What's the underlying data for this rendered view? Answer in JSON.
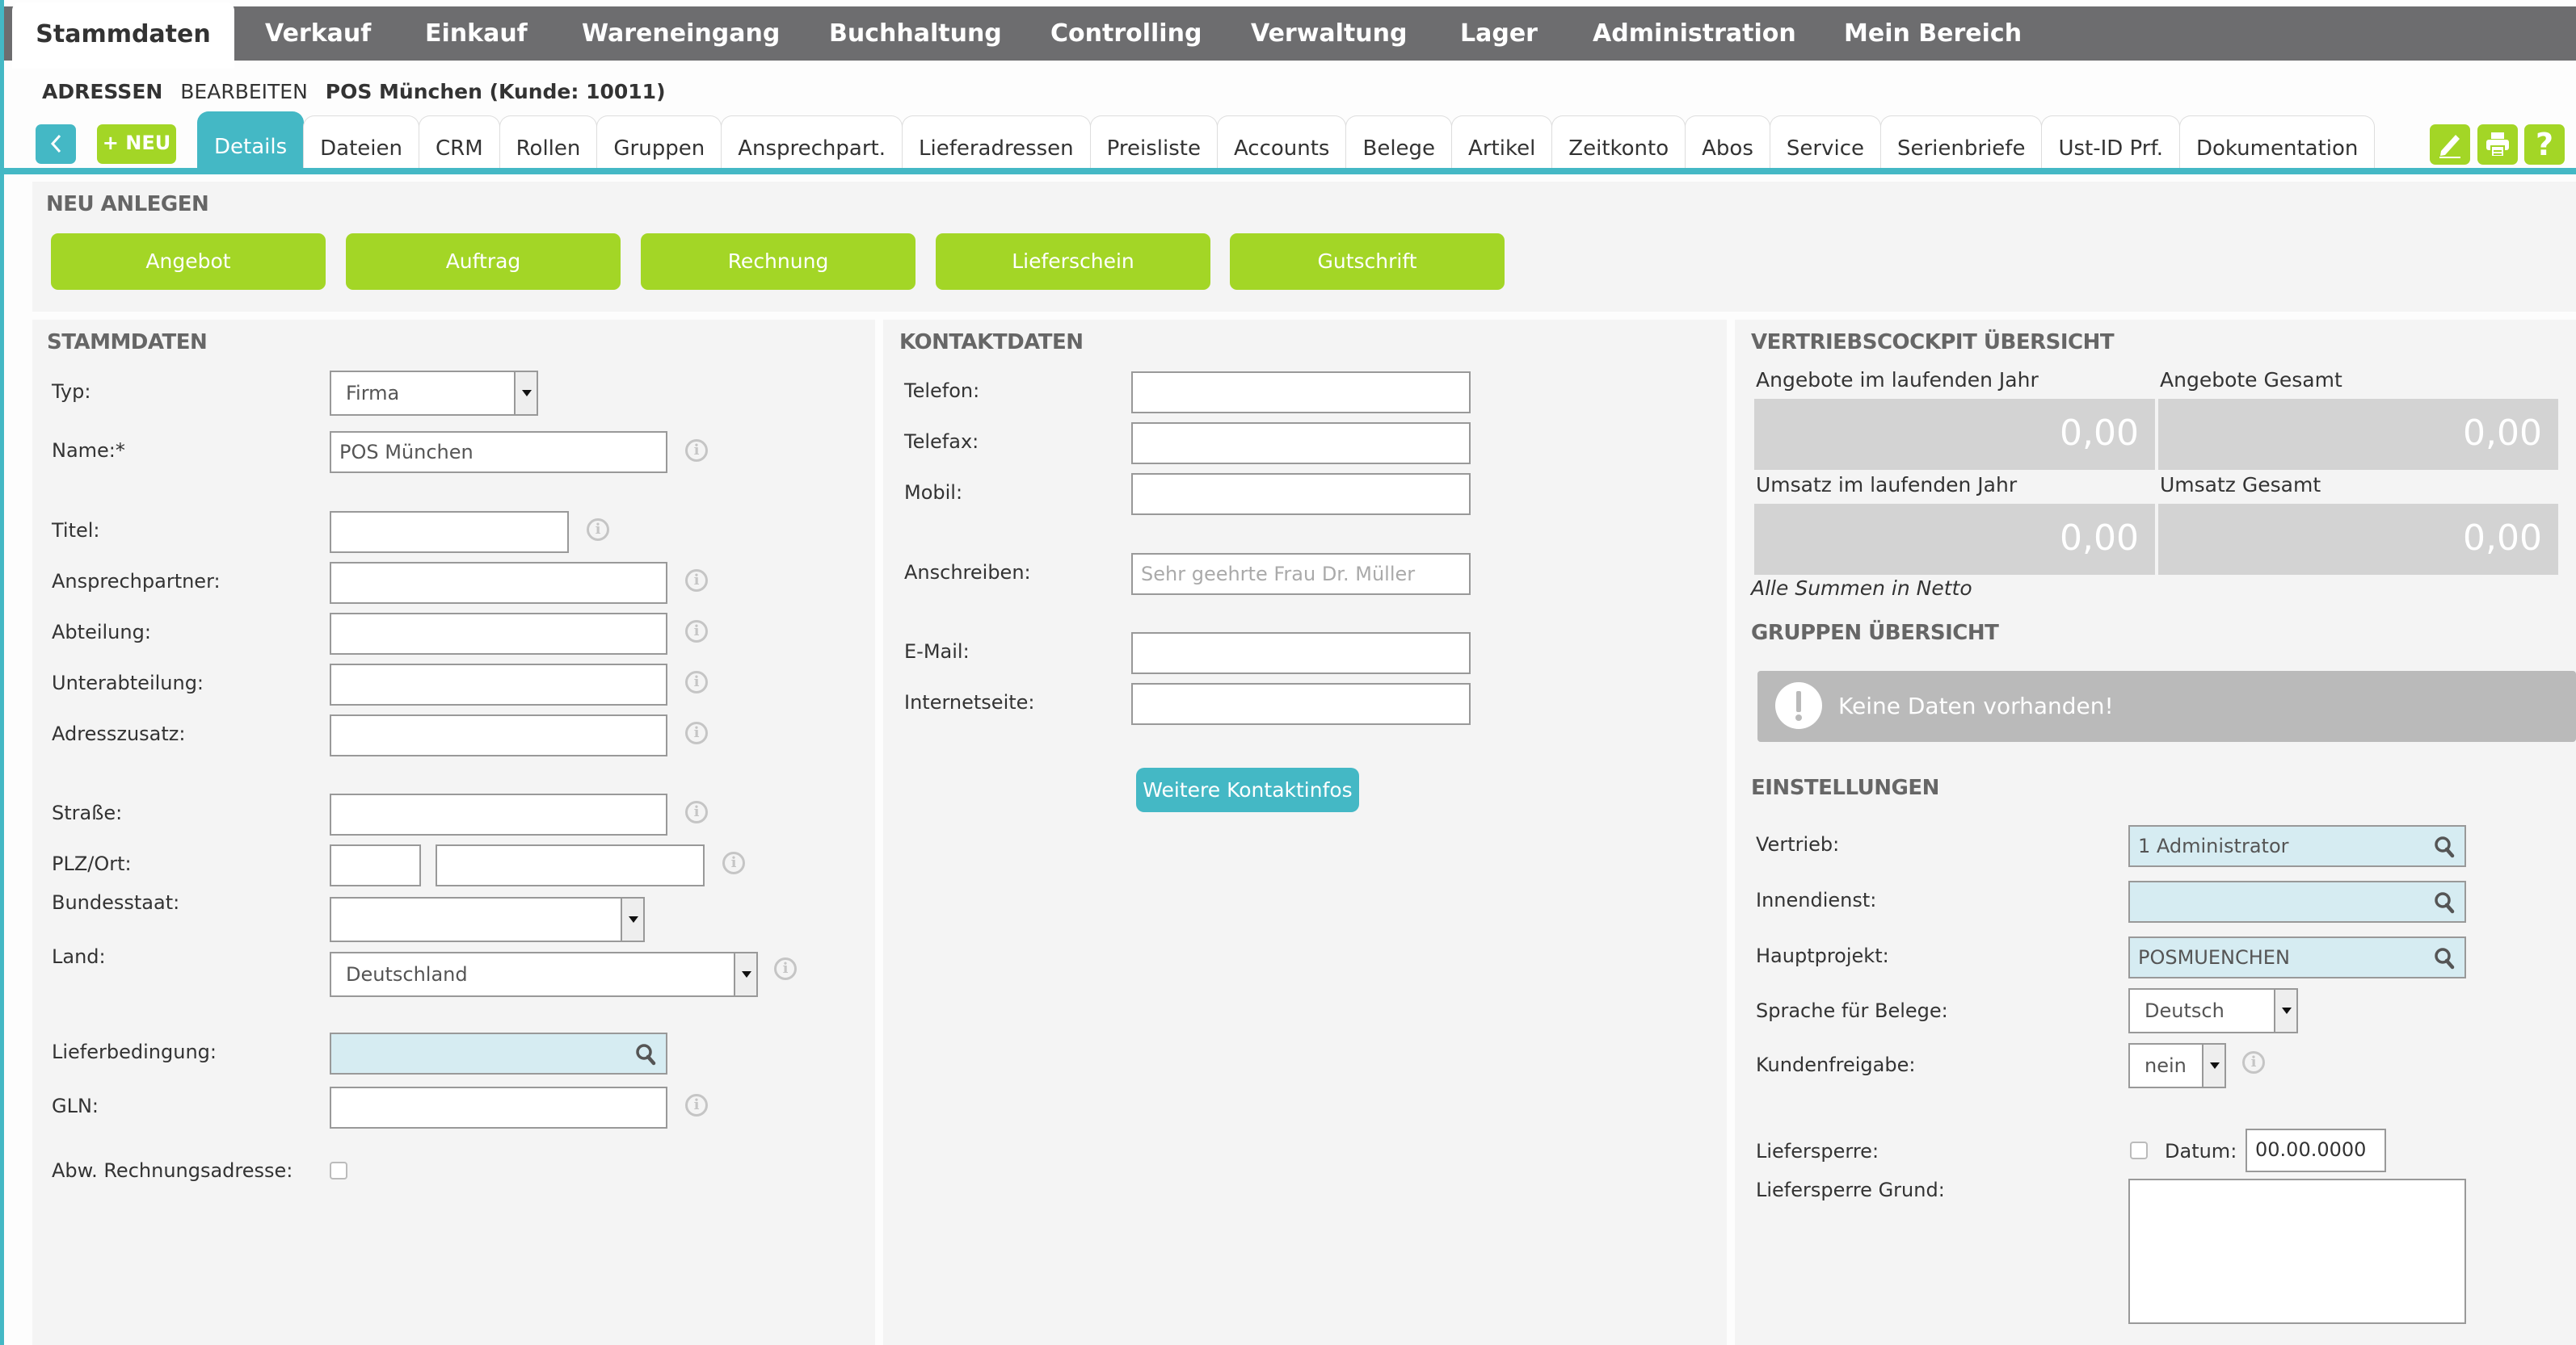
{
  "topnav": {
    "items": [
      "Stammdaten",
      "Verkauf",
      "Einkauf",
      "Wareneingang",
      "Buchhaltung",
      "Controlling",
      "Verwaltung",
      "Lager",
      "Administration",
      "Mein Bereich"
    ],
    "active": "Stammdaten"
  },
  "breadcrumb": {
    "module": "ADRESSEN",
    "action": "BEARBEITEN",
    "record": "POS München (Kunde: 10011)"
  },
  "toolbar": {
    "back_icon": "chevron-left-icon",
    "new_label": "+ NEU",
    "right_icons": [
      "pencil-icon",
      "printer-icon",
      "help-icon"
    ]
  },
  "tabs": [
    "Details",
    "Dateien",
    "CRM",
    "Rollen",
    "Gruppen",
    "Ansprechpart.",
    "Lieferadressen",
    "Preisliste",
    "Accounts",
    "Belege",
    "Artikel",
    "Zeitkonto",
    "Abos",
    "Service",
    "Serienbriefe",
    "Ust-ID Prf.",
    "Dokumentation"
  ],
  "active_tab": "Details",
  "neu_anlegen": {
    "title": "NEU ANLEGEN",
    "buttons": [
      "Angebot",
      "Auftrag",
      "Rechnung",
      "Lieferschein",
      "Gutschrift"
    ]
  },
  "stammdaten": {
    "title": "STAMMDATEN",
    "typ": {
      "label": "Typ:",
      "value": "Firma"
    },
    "name": {
      "label": "Name:*",
      "value": "POS München"
    },
    "titel": {
      "label": "Titel:",
      "value": ""
    },
    "ansprechpartner": {
      "label": "Ansprechpartner:",
      "value": ""
    },
    "abteilung": {
      "label": "Abteilung:",
      "value": ""
    },
    "unterabteilung": {
      "label": "Unterabteilung:",
      "value": ""
    },
    "adresszusatz": {
      "label": "Adresszusatz:",
      "value": ""
    },
    "strasse": {
      "label": "Straße:",
      "value": ""
    },
    "plz_ort": {
      "label": "PLZ/Ort:",
      "plz": "",
      "ort": ""
    },
    "bundesstaat": {
      "label": "Bundesstaat:",
      "value": ""
    },
    "land": {
      "label": "Land:",
      "value": "Deutschland"
    },
    "lieferbedingung": {
      "label": "Lieferbedingung:",
      "value": ""
    },
    "gln": {
      "label": "GLN:",
      "value": ""
    },
    "abw_rechnungsadresse": {
      "label": "Abw. Rechnungsadresse:",
      "checked": false
    }
  },
  "kontaktdaten": {
    "title": "KONTAKTDATEN",
    "telefon": {
      "label": "Telefon:",
      "value": ""
    },
    "telefax": {
      "label": "Telefax:",
      "value": ""
    },
    "mobil": {
      "label": "Mobil:",
      "value": ""
    },
    "anschreiben": {
      "label": "Anschreiben:",
      "value": "",
      "placeholder": "Sehr geehrte Frau Dr. Müller"
    },
    "email": {
      "label": "E-Mail:",
      "value": ""
    },
    "internetseite": {
      "label": "Internetseite:",
      "value": ""
    },
    "more_button": "Weitere Kontaktinfos"
  },
  "vertriebscockpit": {
    "title": "VERTRIEBSCOCKPIT ÜBERSICHT",
    "kpis": [
      {
        "label": "Angebote im laufenden Jahr",
        "value": "0,00"
      },
      {
        "label": "Angebote Gesamt",
        "value": "0,00"
      },
      {
        "label": "Umsatz im laufenden Jahr",
        "value": "0,00"
      },
      {
        "label": "Umsatz Gesamt",
        "value": "0,00"
      }
    ],
    "note": "Alle Summen in Netto"
  },
  "gruppen": {
    "title": "GRUPPEN ÜBERSICHT",
    "empty_message": "Keine Daten vorhanden!"
  },
  "einstellungen": {
    "title": "EINSTELLUNGEN",
    "vertrieb": {
      "label": "Vertrieb:",
      "value": "1 Administrator"
    },
    "innendienst": {
      "label": "Innendienst:",
      "value": ""
    },
    "hauptprojekt": {
      "label": "Hauptprojekt:",
      "value": "POSMUENCHEN"
    },
    "sprache": {
      "label": "Sprache für Belege:",
      "value": "Deutsch"
    },
    "kundenfreigabe": {
      "label": "Kundenfreigabe:",
      "value": "nein"
    },
    "liefersperre": {
      "label": "Liefersperre:",
      "checked": false,
      "datum_label": "Datum:",
      "datum_value": "00.00.0000"
    },
    "liefersperre_grund": {
      "label": "Liefersperre Grund:",
      "value": ""
    }
  },
  "colors": {
    "accent_teal": "#44b8c5",
    "accent_green": "#a3d626",
    "nav_gray": "#6d6d6f",
    "lookup_blue": "#d6ecf2",
    "panel_bg": "#f4f4f4"
  }
}
